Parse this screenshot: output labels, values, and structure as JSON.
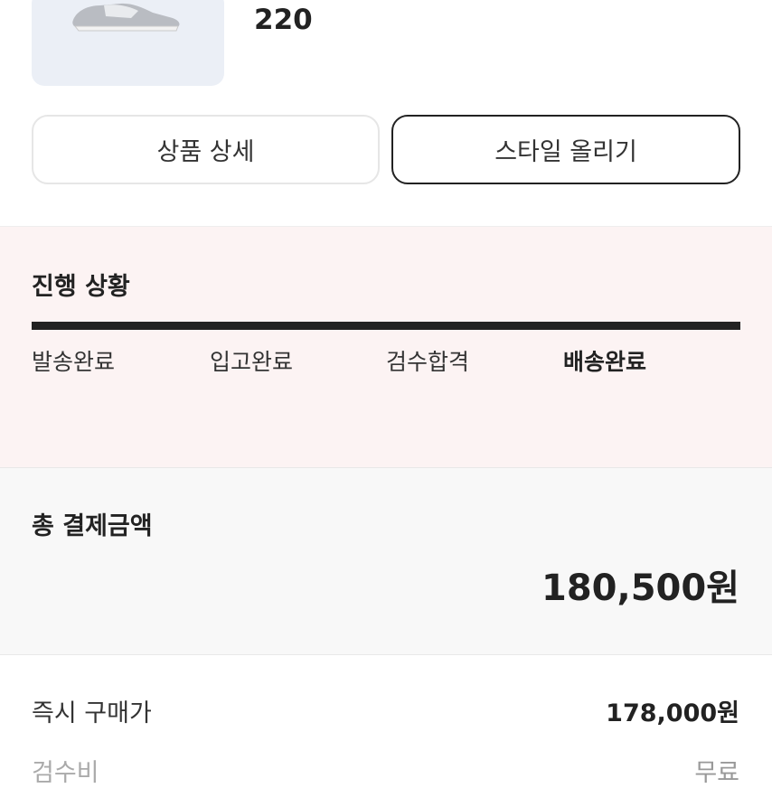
{
  "product": {
    "size": "220",
    "image_icon": "sneaker-image"
  },
  "actions": {
    "detail_label": "상품 상세",
    "style_label": "스타일 올리기"
  },
  "progress": {
    "title": "진행 상황",
    "progress_fraction": 1.0,
    "steps": [
      {
        "label": "발송완료",
        "active": false
      },
      {
        "label": "입고완료",
        "active": false
      },
      {
        "label": "검수합격",
        "active": false
      },
      {
        "label": "배송완료",
        "active": true
      }
    ]
  },
  "payment": {
    "total_title": "총 결제금액",
    "total_amount": "180,500원",
    "rows": [
      {
        "label": "즉시 구매가",
        "value": "178,000원"
      },
      {
        "label": "검수비",
        "value": "무료"
      }
    ]
  },
  "colors": {
    "progress_bg": "#fcf3f3",
    "total_bg": "#f8f8f8",
    "accent": "#222222"
  }
}
